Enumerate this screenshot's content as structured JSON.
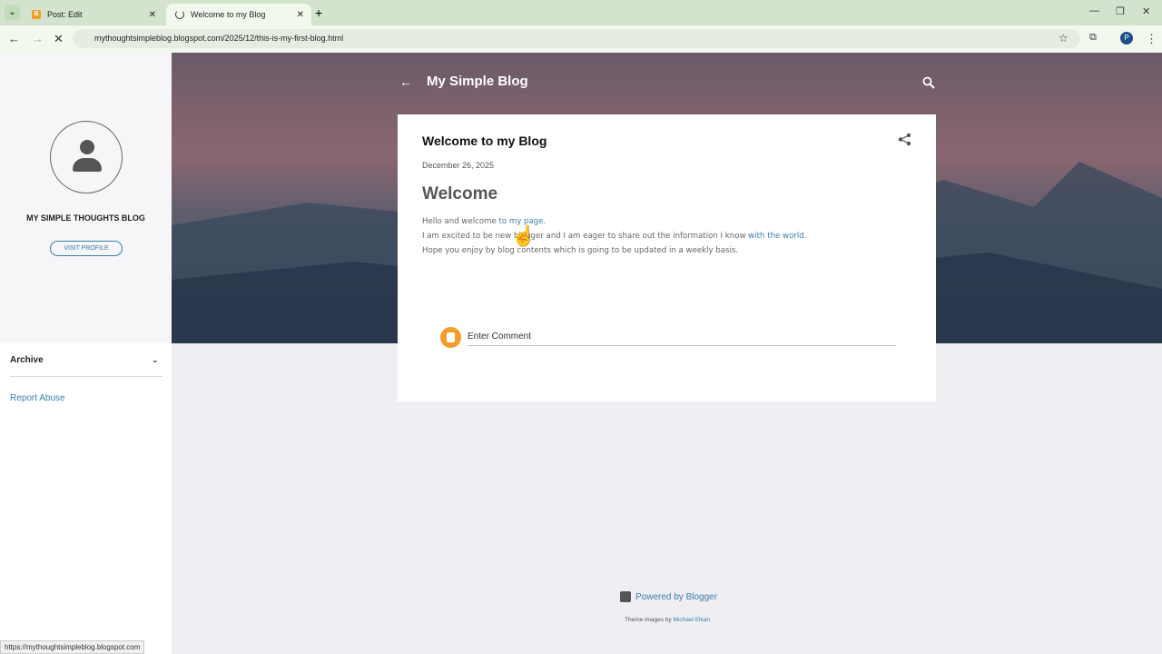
{
  "browser": {
    "tabs": [
      {
        "label": "Post: Edit"
      },
      {
        "label": "Welcome to my Blog"
      }
    ],
    "url": "mythoughtsimpleblog.blogspot.com/2025/12/this-is-my-first-blog.html",
    "profile_initial": "P",
    "status_url": "https://mythoughtsimpleblog.blogspot.com"
  },
  "sidebar": {
    "blog_name": "MY SIMPLE THOUGHTS BLOG",
    "visit_profile": "VISIT PROFILE",
    "archive": "Archive",
    "report_abuse": "Report Abuse"
  },
  "header": {
    "title": "My Simple Blog"
  },
  "post": {
    "title": "Welcome to my Blog",
    "date": "December 26, 2025",
    "heading": "Welcome",
    "line1_text": "Hello and welcome ",
    "line1_link": "to my page",
    "line1_end": ".",
    "line2_text": "I am excited to be new blogger and I am eager to share out the information I know ",
    "line2_link": "with the world",
    "line2_end": ".",
    "line3": "Hope you enjoy by blog contents which is going to be updated in a weekly basis."
  },
  "comment": {
    "placeholder": "Enter Comment"
  },
  "footer": {
    "powered": "Powered by Blogger",
    "theme_prefix": "Theme images by ",
    "theme_author": "Michael Elkan"
  }
}
